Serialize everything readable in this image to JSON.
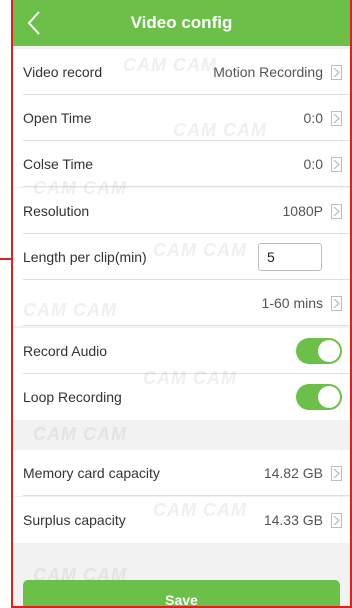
{
  "header": {
    "title": "Video config",
    "back_icon": "chevron-left-icon"
  },
  "rows": {
    "video_record": {
      "label": "Video record",
      "value": "Motion Recording"
    },
    "open_time": {
      "label": "Open Time",
      "value": "0:0"
    },
    "close_time": {
      "label": "Colse Time",
      "value": "0:0"
    },
    "resolution": {
      "label": "Resolution",
      "value": "1080P"
    },
    "clip_length": {
      "label": "Length per clip(min)",
      "value": "5"
    },
    "clip_range": {
      "value": "1-60 mins"
    },
    "record_audio": {
      "label": "Record Audio",
      "on": true
    },
    "loop_recording": {
      "label": "Loop Recording",
      "on": true
    },
    "memory_capacity": {
      "label": "Memory card capacity",
      "value": "14.82 GB"
    },
    "surplus_capacity": {
      "label": "Surplus capacity",
      "value": "14.33 GB"
    }
  },
  "save_label": "Save",
  "watermark": "CAM CAM",
  "colors": {
    "accent": "#6cc04a",
    "border": "#e02020"
  }
}
